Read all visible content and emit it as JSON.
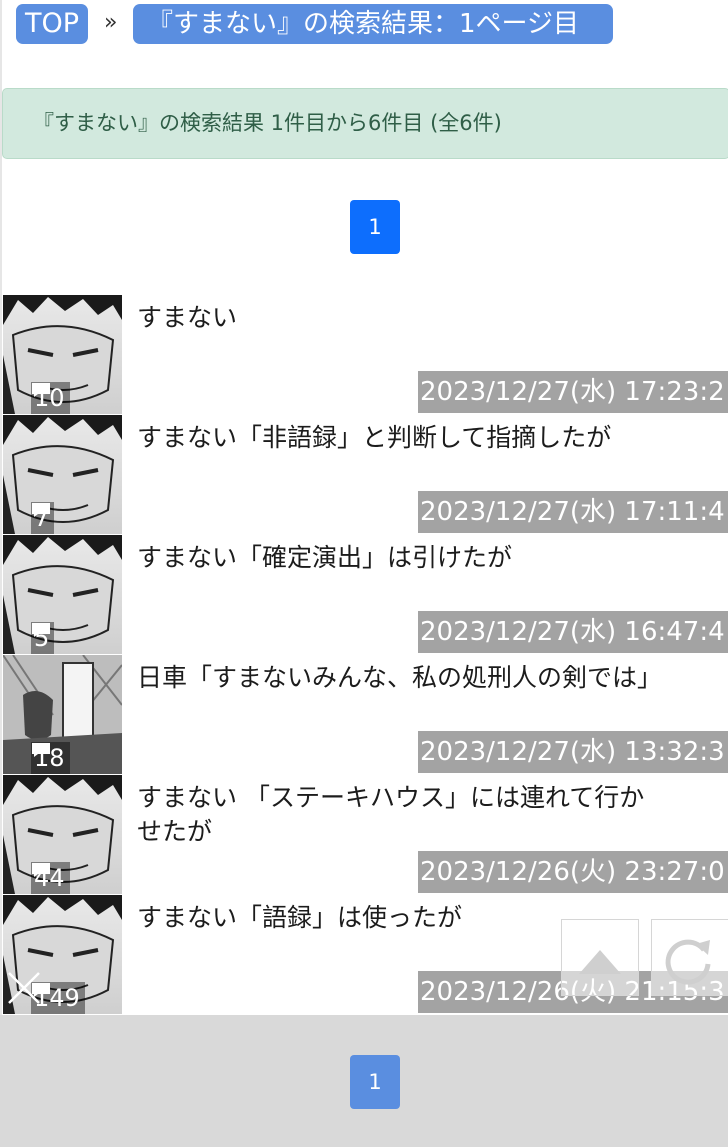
{
  "breadcrumb": {
    "top_label": "TOP",
    "separator": "»",
    "current_label": "『すまない』の検索結果：1ページ目"
  },
  "notice": {
    "text": "『すまない』の検索結果 1件目から6件目 (全6件)"
  },
  "pagination": {
    "current_page": "1"
  },
  "results": [
    {
      "title": "すまない",
      "comments": "10",
      "datetime": "2023/12/27(水) 17:23:2"
    },
    {
      "title": "すまない「非語録」と判断して指摘したが",
      "comments": "7",
      "datetime": "2023/12/27(水) 17:11:4"
    },
    {
      "title": "すまない「確定演出」は引けたが",
      "comments": "5",
      "datetime": "2023/12/27(水) 16:47:4"
    },
    {
      "title": "日車「すまないみんな、私の処刑人の剣では」",
      "comments": "18",
      "datetime": "2023/12/27(水) 13:32:3"
    },
    {
      "title": "すまない 「ステーキハウス」には連れて行かせたが",
      "comments": "44",
      "datetime": "2023/12/26(火) 23:27:0"
    },
    {
      "title": "すまない「語録」は使ったが",
      "comments": "149",
      "datetime": "2023/12/26(火) 21:15:3"
    }
  ],
  "icons": {
    "comment": "speech-bubble-icon",
    "scroll_top": "arrow-up-icon",
    "reload": "reload-icon",
    "close": "close-icon"
  },
  "colors": {
    "accent": "#5a8ee0",
    "active_page": "#0d6efd",
    "notice_bg": "#d2e9de",
    "notice_text": "#2f5e47",
    "timestamp_bg": "#a3a3a3"
  }
}
